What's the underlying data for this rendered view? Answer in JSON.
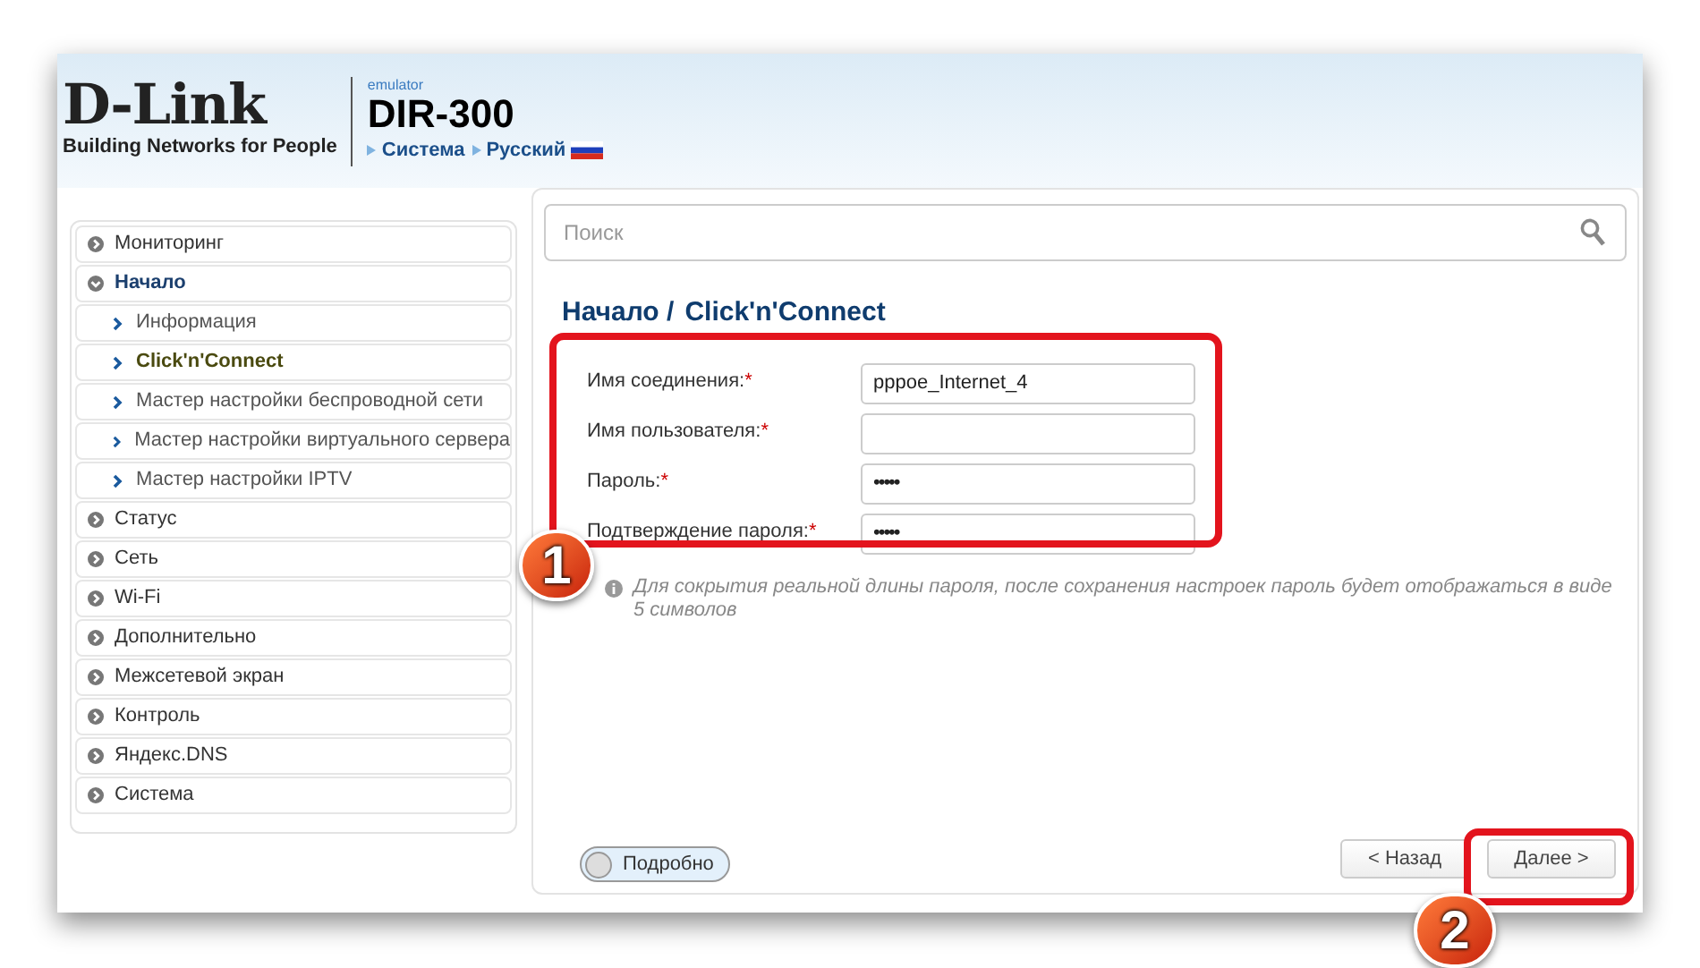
{
  "header": {
    "brand": "D-Link",
    "tagline": "Building Networks for People",
    "emulator_label": "emulator",
    "model": "DIR-300",
    "links": [
      {
        "label": "Система"
      },
      {
        "label": "Русский"
      }
    ]
  },
  "sidebar": {
    "items": [
      {
        "label": "Мониторинг",
        "expanded": false,
        "selected": false
      },
      {
        "label": "Начало",
        "expanded": true,
        "selected": false,
        "children": [
          {
            "label": "Информация",
            "selected": false
          },
          {
            "label": "Click'n'Connect",
            "selected": true
          },
          {
            "label": "Мастер настройки беспроводной сети",
            "selected": false
          },
          {
            "label": "Мастер настройки виртуального сервера",
            "selected": false
          },
          {
            "label": "Мастер настройки IPTV",
            "selected": false
          }
        ]
      },
      {
        "label": "Статус",
        "expanded": false,
        "selected": false
      },
      {
        "label": "Сеть",
        "expanded": false,
        "selected": false
      },
      {
        "label": "Wi-Fi",
        "expanded": false,
        "selected": false
      },
      {
        "label": "Дополнительно",
        "expanded": false,
        "selected": false
      },
      {
        "label": "Межсетевой экран",
        "expanded": false,
        "selected": false
      },
      {
        "label": "Контроль",
        "expanded": false,
        "selected": false
      },
      {
        "label": "Яндекс.DNS",
        "expanded": false,
        "selected": false
      },
      {
        "label": "Система",
        "expanded": false,
        "selected": false
      }
    ]
  },
  "search": {
    "placeholder": "Поиск"
  },
  "breadcrumb": [
    "Начало /",
    "Click'n'Connect"
  ],
  "form": {
    "fields": [
      {
        "label": "Имя соединения:",
        "required": "*",
        "kind": "text",
        "value": "pppoe_Internet_4"
      },
      {
        "label": "Имя пользователя:",
        "required": "*",
        "kind": "text"
      },
      {
        "label": "Пароль:",
        "required": "*",
        "kind": "password",
        "value": "•••••"
      },
      {
        "label": "Подтверждение пароля:",
        "required": "*",
        "kind": "password",
        "value": "•••••"
      }
    ],
    "hint": "Для сокрытия реальной длины пароля, после сохранения настроек пароль будет отображаться в виде 5 символов"
  },
  "details_toggle": {
    "label": "Подробно",
    "on": false
  },
  "buttons": [
    {
      "label": "< Назад"
    },
    {
      "label": "Далее >"
    }
  ],
  "annotations": [
    {
      "number": "1"
    },
    {
      "number": "2"
    }
  ]
}
